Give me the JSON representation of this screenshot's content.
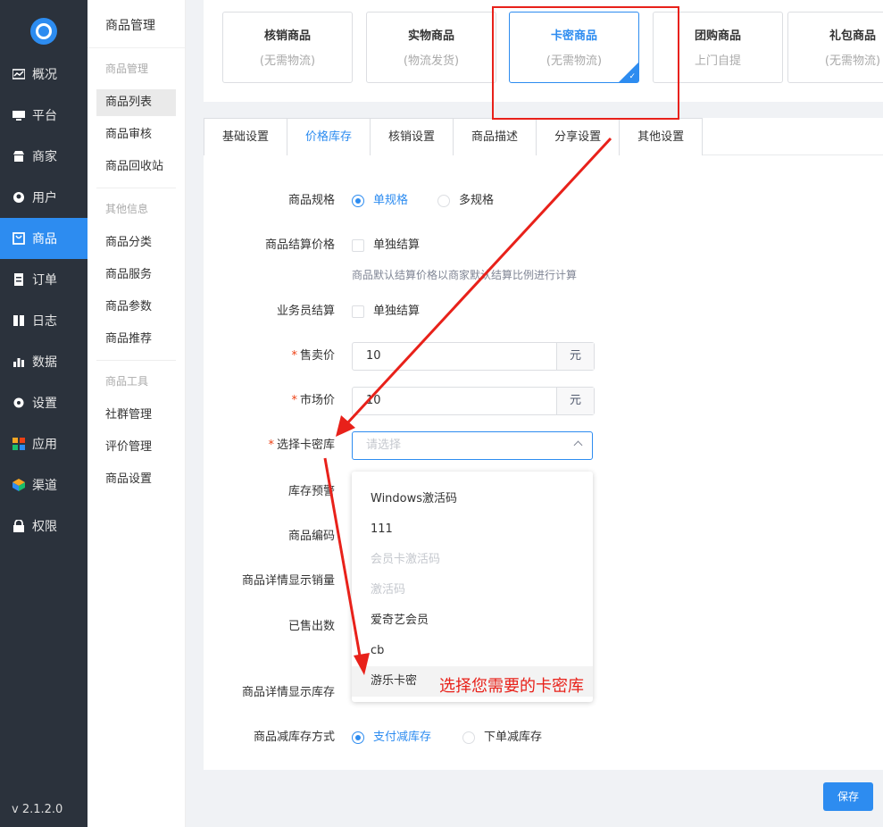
{
  "sidebar": {
    "items": [
      {
        "label": "概况",
        "icon": "chart-icon"
      },
      {
        "label": "平台",
        "icon": "monitor-icon"
      },
      {
        "label": "商家",
        "icon": "store-icon"
      },
      {
        "label": "用户",
        "icon": "user-icon"
      },
      {
        "label": "商品",
        "icon": "bag-icon",
        "active": true
      },
      {
        "label": "订单",
        "icon": "order-icon"
      },
      {
        "label": "日志",
        "icon": "book-icon"
      },
      {
        "label": "数据",
        "icon": "bar-chart-icon"
      },
      {
        "label": "设置",
        "icon": "gear-icon"
      },
      {
        "label": "应用",
        "icon": "apps-icon"
      },
      {
        "label": "渠道",
        "icon": "cube-icon"
      },
      {
        "label": "权限",
        "icon": "lock-icon"
      }
    ],
    "version": "v 2.1.2.0"
  },
  "submenu": {
    "title": "商品管理",
    "groups": [
      {
        "heading": "商品管理",
        "items": [
          "商品列表",
          "商品审核",
          "商品回收站"
        ]
      },
      {
        "heading": "其他信息",
        "items": [
          "商品分类",
          "商品服务",
          "商品参数",
          "商品推荐"
        ]
      },
      {
        "heading": "商品工具",
        "items": [
          "社群管理",
          "评价管理",
          "商品设置"
        ]
      }
    ]
  },
  "product_types": [
    {
      "title": "核销商品",
      "sub": "(无需物流)"
    },
    {
      "title": "实物商品",
      "sub": "(物流发货)"
    },
    {
      "title": "卡密商品",
      "sub": "(无需物流)",
      "selected": true
    },
    {
      "title": "团购商品",
      "sub": "上门自提"
    },
    {
      "title": "礼包商品",
      "sub": "(无需物流)"
    }
  ],
  "tabs": [
    "基础设置",
    "价格库存",
    "核销设置",
    "商品描述",
    "分享设置",
    "其他设置"
  ],
  "form": {
    "spec": {
      "label": "商品规格",
      "options": [
        "单规格",
        "多规格"
      ]
    },
    "settle": {
      "label": "商品结算价格",
      "checkbox": "单独结算",
      "hint": "商品默认结算价格以商家默认结算比例进行计算"
    },
    "salesman": {
      "label": "业务员结算",
      "checkbox": "单独结算"
    },
    "price": {
      "label": "售卖价",
      "value": "10",
      "unit": "元"
    },
    "market_price": {
      "label": "市场价",
      "value": "10",
      "unit": "元"
    },
    "card_lib": {
      "label": "选择卡密库",
      "placeholder": "请选择"
    },
    "stock_warn": {
      "label": "库存预警"
    },
    "code": {
      "label": "商品编码"
    },
    "show_sales": {
      "label": "商品详情显示销量"
    },
    "sold": {
      "label": "已售出数"
    },
    "show_stock": {
      "label": "商品详情显示库存"
    },
    "reduce": {
      "label": "商品减库存方式",
      "options": [
        "支付减库存",
        "下单减库存"
      ]
    }
  },
  "dropdown": [
    {
      "label": "Windows激活码",
      "disabled": false
    },
    {
      "label": "111",
      "disabled": false
    },
    {
      "label": "会员卡激活码",
      "disabled": true
    },
    {
      "label": "激活码",
      "disabled": true
    },
    {
      "label": "爱奇艺会员",
      "disabled": false
    },
    {
      "label": "cb",
      "disabled": false
    },
    {
      "label": "游乐卡密",
      "disabled": false,
      "hover": true
    }
  ],
  "save_label": "保存",
  "annotation": "选择您需要的卡密库",
  "colors": {
    "primary": "#2d8cf0",
    "sidebar": "#2b323c",
    "annotation": "#e8211a",
    "required": "#ed4014"
  }
}
